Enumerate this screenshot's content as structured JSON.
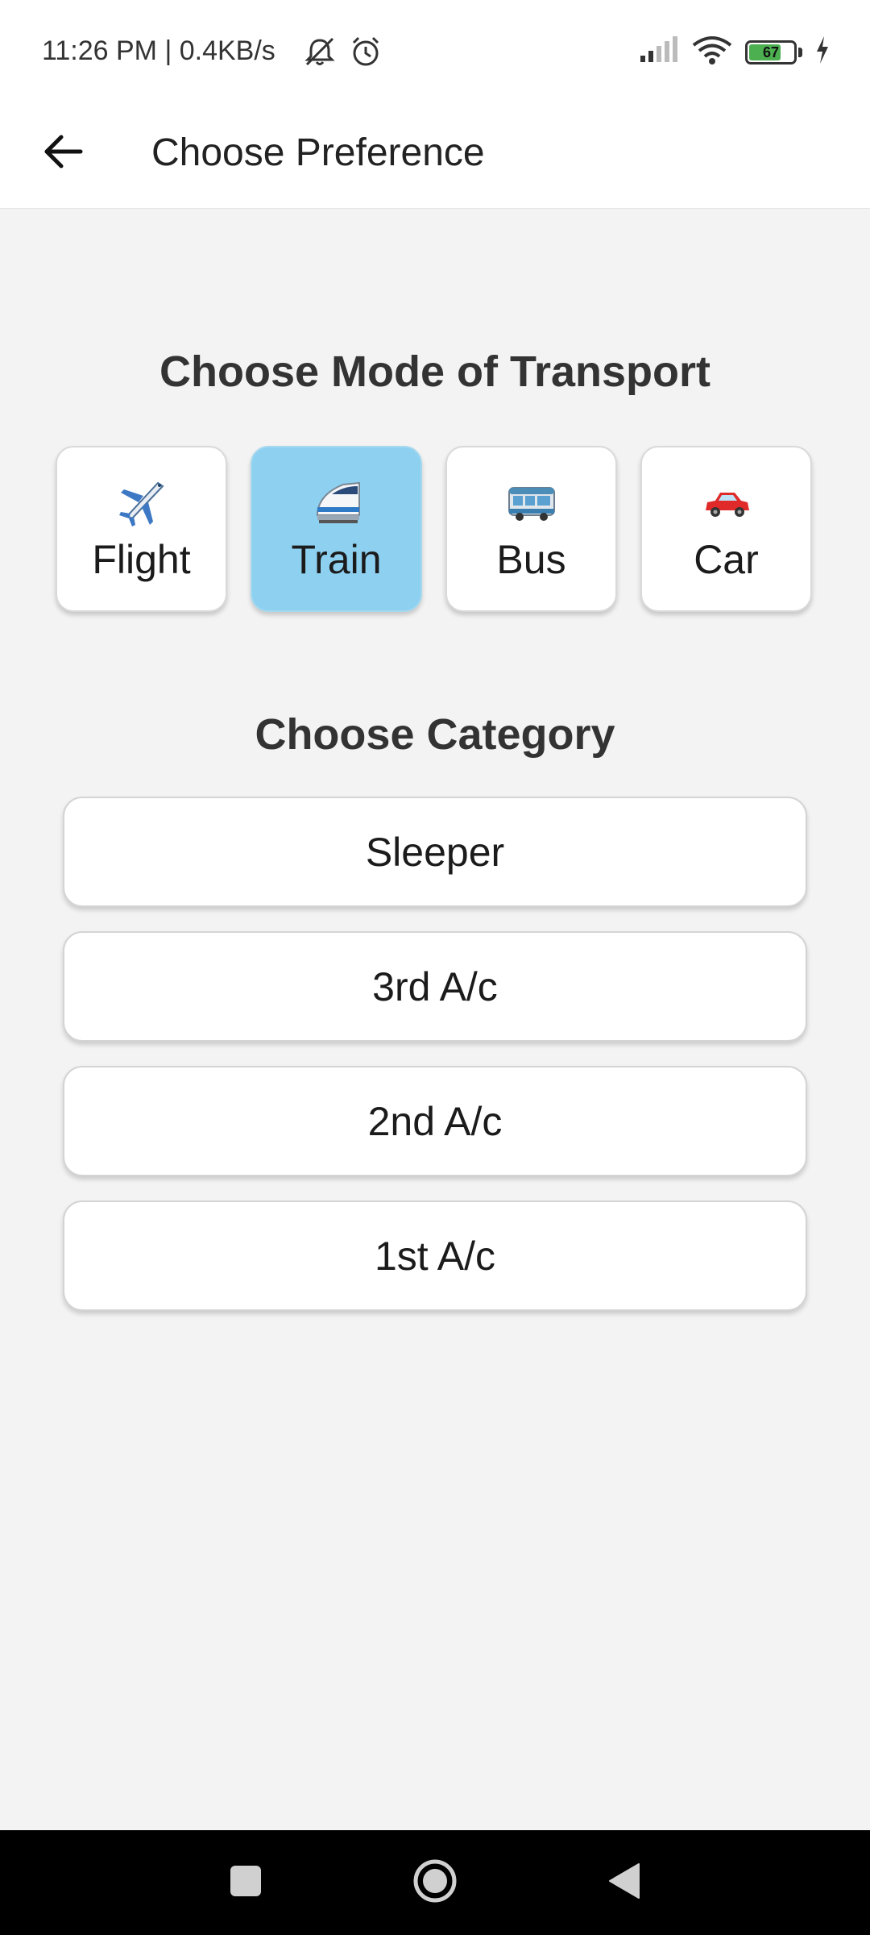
{
  "status_bar": {
    "time": "11:26 PM | 0.4KB/s",
    "battery_level": "67",
    "icons": [
      "mute-icon",
      "alarm-icon",
      "signal-icon",
      "wifi-icon",
      "battery-icon",
      "charging-icon"
    ]
  },
  "app_bar": {
    "title": "Choose Preference",
    "back_icon": "arrow-back-icon"
  },
  "transport": {
    "heading": "Choose Mode of Transport",
    "selected": "Train",
    "modes": [
      {
        "label": "Flight",
        "icon": "airplane-icon"
      },
      {
        "label": "Train",
        "icon": "train-icon"
      },
      {
        "label": "Bus",
        "icon": "bus-icon"
      },
      {
        "label": "Car",
        "icon": "car-icon"
      }
    ]
  },
  "category": {
    "heading": "Choose Category",
    "options": [
      "Sleeper",
      "3rd A/c",
      "2nd A/c",
      "1st A/c"
    ]
  },
  "nav_bar": {
    "buttons": [
      "recents-icon",
      "home-icon",
      "back-icon"
    ]
  },
  "colors": {
    "selected_mode": "#8dd0f0",
    "background": "#f3f3f3"
  }
}
